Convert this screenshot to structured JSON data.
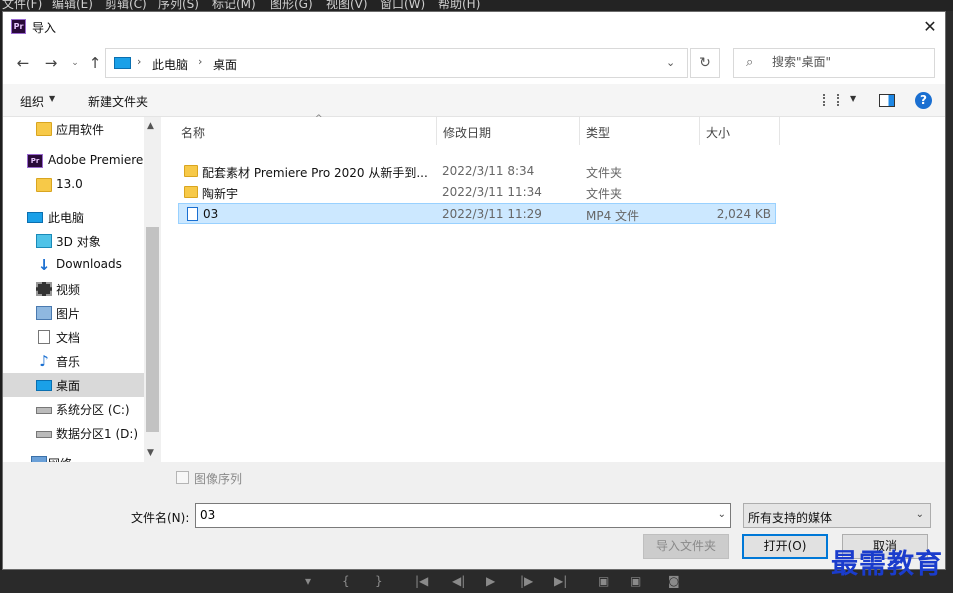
{
  "app_menu": [
    "文件(F)",
    "编辑(E)",
    "剪辑(C)",
    "序列(S)",
    "标记(M)",
    "图形(G)",
    "视图(V)",
    "窗口(W)",
    "帮助(H)"
  ],
  "dialog": {
    "badge": "Pr",
    "title": "导入",
    "close": "✕"
  },
  "nav": {
    "back": "←",
    "forward": "→",
    "recent": "⌄",
    "up": "↑",
    "breadcrumb": [
      "此电脑",
      "桌面"
    ],
    "search_placeholder": "搜索\"桌面\""
  },
  "toolbar": {
    "organize": "组织",
    "new_folder": "新建文件夹",
    "help": "?"
  },
  "tree": [
    {
      "label": "应用软件",
      "icon": "folder-icon"
    },
    {
      "label": "Adobe Premiere",
      "icon": "premiere-icon"
    },
    {
      "label": "13.0",
      "icon": "folder-icon"
    },
    {
      "label": "此电脑",
      "icon": "computer-icon"
    },
    {
      "label": "3D 对象",
      "icon": "cube-icon"
    },
    {
      "label": "Downloads",
      "icon": "download-icon"
    },
    {
      "label": "视频",
      "icon": "video-icon"
    },
    {
      "label": "图片",
      "icon": "picture-icon"
    },
    {
      "label": "文档",
      "icon": "document-icon"
    },
    {
      "label": "音乐",
      "icon": "music-icon"
    },
    {
      "label": "桌面",
      "icon": "desktop-icon"
    },
    {
      "label": "系统分区 (C:)",
      "icon": "drive-icon"
    },
    {
      "label": "数据分区1 (D:)",
      "icon": "drive-icon"
    },
    {
      "label": "网络",
      "icon": "network-icon"
    }
  ],
  "columns": [
    "名称",
    "修改日期",
    "类型",
    "大小"
  ],
  "files": [
    {
      "name": "配套素材 Premiere Pro 2020 从新手到...",
      "date": "2022/3/11 8:34",
      "type": "文件夹",
      "size": ""
    },
    {
      "name": "陶新宇",
      "date": "2022/3/11 11:34",
      "type": "文件夹",
      "size": ""
    },
    {
      "name": "03",
      "date": "2022/3/11 11:29",
      "type": "MP4 文件",
      "size": "2,024 KB"
    }
  ],
  "bottom": {
    "image_sequence": "图像序列",
    "filename_label": "文件名(N):",
    "filename_value": "03",
    "filter": "所有支持的媒体",
    "import_folder": "导入文件夹",
    "open": "打开(O)",
    "cancel": "取消"
  },
  "watermark": "最需教育"
}
